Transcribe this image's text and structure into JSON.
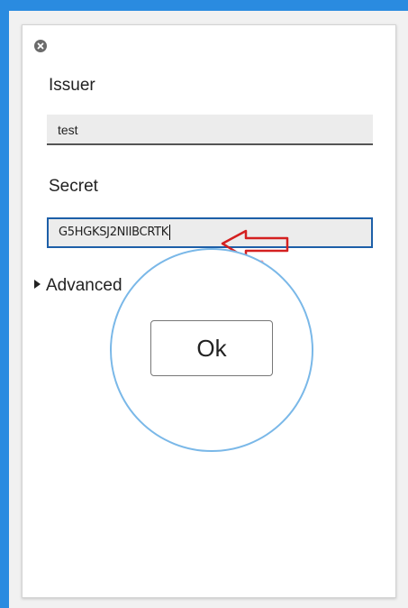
{
  "dialog": {
    "issuer_label": "Issuer",
    "issuer_value": "test",
    "secret_label": "Secret",
    "secret_value": "G5HGKSJ2NIIBCRTK",
    "advanced_label": "Advanced",
    "ok_label": "Ok"
  },
  "icons": {
    "close": "close-icon",
    "arrow": "arrow-left-icon",
    "disclosure": "triangle-right-icon"
  },
  "colors": {
    "frame_border": "#2a8be0",
    "secret_focus_border": "#1d5fa8",
    "arrow_annotation": "#d42020",
    "magnifier_ring": "#7ab8e8"
  }
}
